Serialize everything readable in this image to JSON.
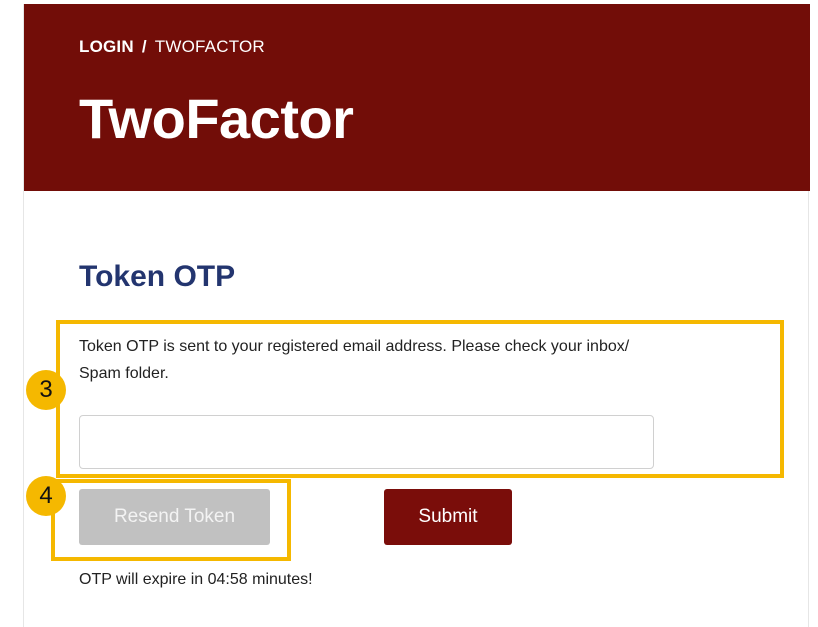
{
  "header": {
    "breadcrumb": [
      "LOGIN",
      "/",
      "TWOFACTOR"
    ],
    "title": "TwoFactor",
    "background_color": "#720d08"
  },
  "main": {
    "section_title": "Token OTP",
    "instruction": "Token OTP is sent to your registered email address. Please check your inbox/ Spam folder.",
    "otp_input": {
      "value": "",
      "placeholder": ""
    },
    "resend_label": "Resend Token",
    "resend_state": "disabled",
    "submit_label": "Submit",
    "expire_text": "OTP will expire in 04:58 minutes!"
  },
  "annotations": [
    {
      "number": "3",
      "color": "#f5b800"
    },
    {
      "number": "4",
      "color": "#f5b800"
    }
  ]
}
